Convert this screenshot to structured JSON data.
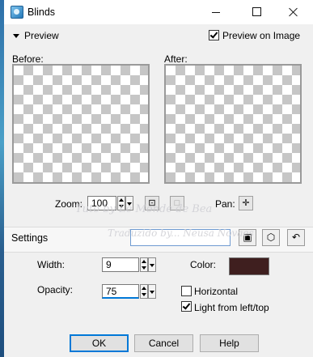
{
  "window": {
    "title": "Blinds",
    "icon": "app-icon"
  },
  "preview": {
    "toggle_label": "Preview",
    "on_image_label": "Preview on Image",
    "on_image_checked": true,
    "before_label": "Before:",
    "after_label": "After:",
    "zoom_label": "Zoom:",
    "zoom_value": "100",
    "pan_label": "Pan:"
  },
  "settings": {
    "title": "Settings",
    "width_label": "Width:",
    "width_value": "9",
    "opacity_label": "Opacity:",
    "opacity_value": "75",
    "color_label": "Color:",
    "color_value": "#3f1f1f",
    "horizontal_label": "Horizontal",
    "horizontal_checked": false,
    "light_label": "Light from left/top",
    "light_checked": true
  },
  "buttons": {
    "ok": "OK",
    "cancel": "Cancel",
    "help": "Help"
  },
  "watermark": {
    "line1": "Tuto by Le Monde de Bea",
    "line2": "Traduzido by... Neusa Novaes"
  }
}
